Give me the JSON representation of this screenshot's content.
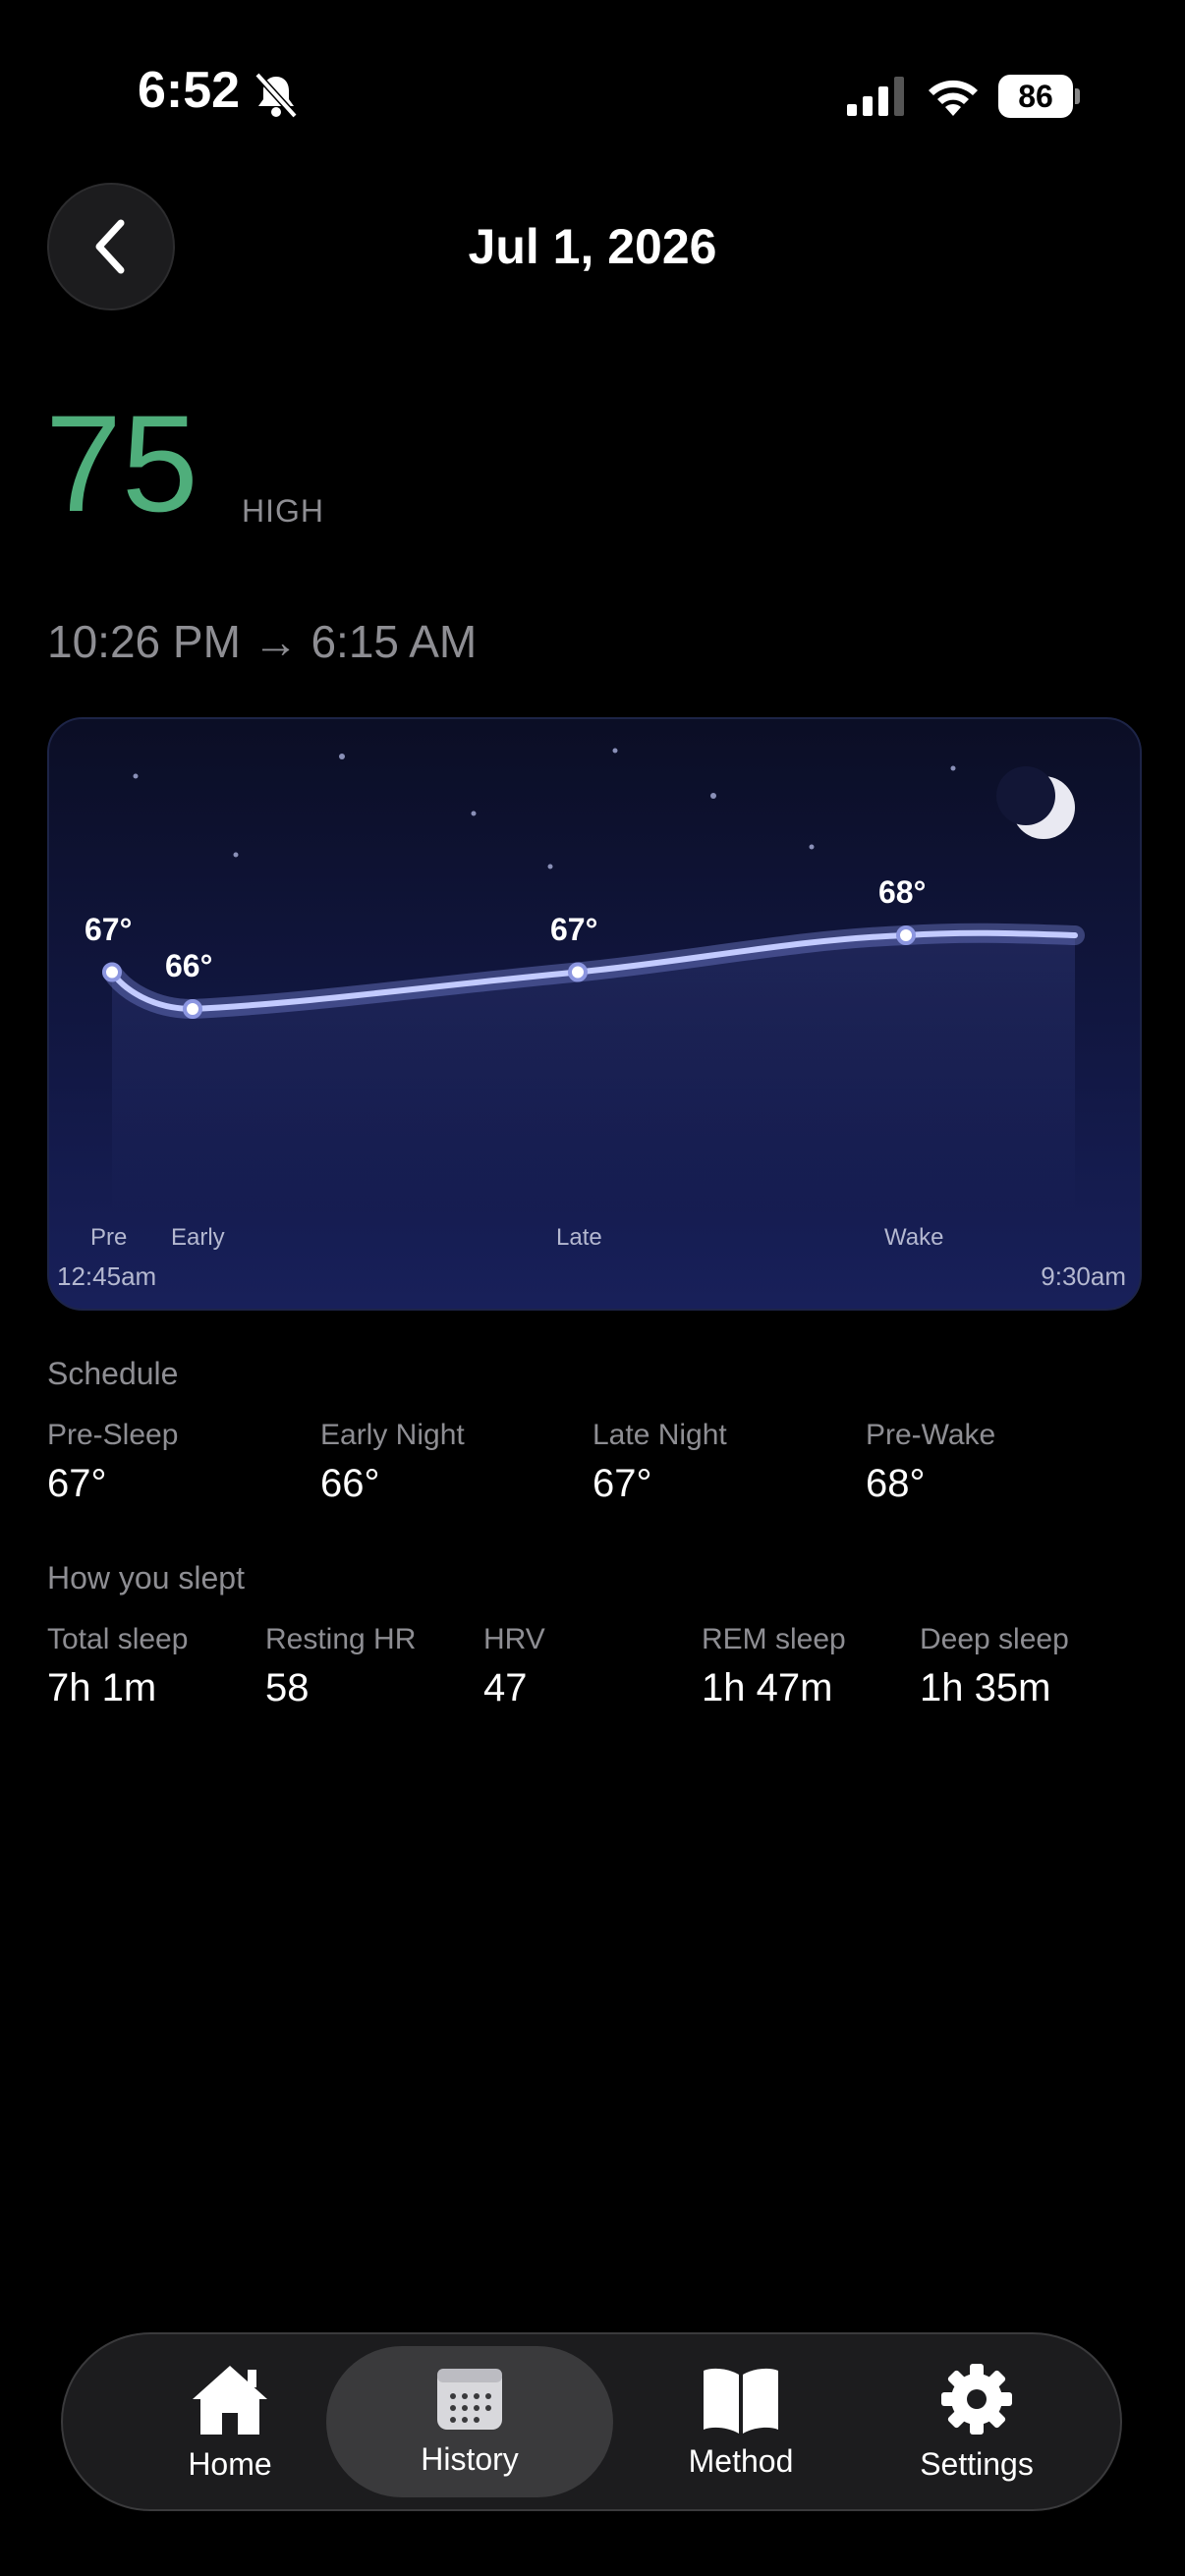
{
  "status": {
    "time": "6:52",
    "battery": "86"
  },
  "header": {
    "title": "Jul 1, 2026"
  },
  "score": {
    "value": "75",
    "level": "HIGH"
  },
  "range": "10:26 PM → 6:15 AM",
  "chart_data": {
    "type": "line",
    "x": [
      "Pre",
      "Early",
      "Late",
      "Wake"
    ],
    "series": [
      {
        "values": [
          67,
          66,
          67,
          68
        ]
      }
    ],
    "point_labels": [
      "67°",
      "66°",
      "67°",
      "68°"
    ],
    "start_time": "12:45am",
    "end_time": "9:30am"
  },
  "schedule": {
    "title": "Schedule",
    "items": [
      {
        "label": "Pre-Sleep",
        "value": "67°"
      },
      {
        "label": "Early Night",
        "value": "66°"
      },
      {
        "label": "Late Night",
        "value": "67°"
      },
      {
        "label": "Pre-Wake",
        "value": "68°"
      }
    ]
  },
  "sleep": {
    "title": "How you slept",
    "items": [
      {
        "label": "Total sleep",
        "value": "7h 1m"
      },
      {
        "label": "Resting HR",
        "value": "58"
      },
      {
        "label": "HRV",
        "value": "47"
      },
      {
        "label": "REM sleep",
        "value": "1h 47m"
      },
      {
        "label": "Deep sleep",
        "value": "1h 35m"
      }
    ]
  },
  "tabs": [
    {
      "label": "Home",
      "icon": "home-icon"
    },
    {
      "label": "History",
      "icon": "calendar-icon",
      "active": true
    },
    {
      "label": "Method",
      "icon": "book-icon"
    },
    {
      "label": "Settings",
      "icon": "gear-icon"
    }
  ],
  "colors": {
    "score": "#4fae7b",
    "line": "#a9b4ff"
  }
}
